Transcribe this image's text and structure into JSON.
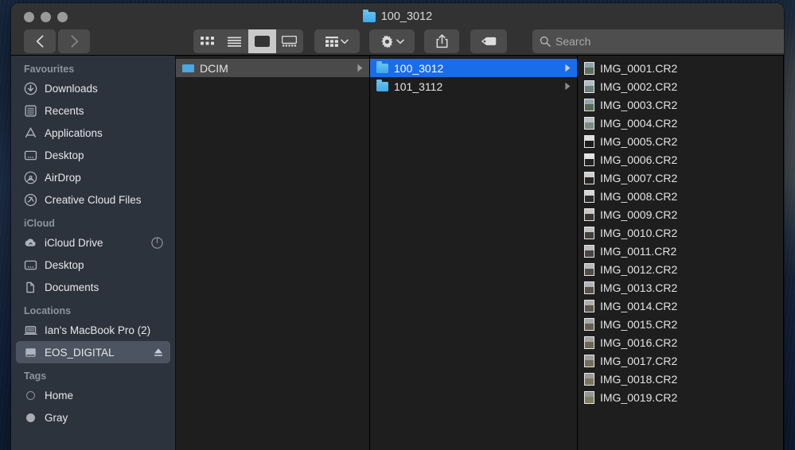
{
  "window": {
    "title": "100_3012",
    "title_icon": "folder-icon"
  },
  "toolbar": {
    "back_label": "Back",
    "forward_label": "Forward",
    "view_modes": [
      {
        "name": "icon-view",
        "label": "Icon View",
        "active": false
      },
      {
        "name": "list-view",
        "label": "List View",
        "active": false
      },
      {
        "name": "column-view",
        "label": "Column View",
        "active": true
      },
      {
        "name": "gallery-view",
        "label": "Gallery View",
        "active": false
      }
    ],
    "arrange_label": "Group",
    "action_label": "Action",
    "share_label": "Share",
    "tags_label": "Tags",
    "search": {
      "placeholder": "Search",
      "value": ""
    }
  },
  "sidebar": {
    "sections": [
      {
        "header": "Favourites",
        "items": [
          {
            "label": "Downloads",
            "icon": "downloads-icon",
            "selected": false
          },
          {
            "label": "Recents",
            "icon": "recents-icon",
            "selected": false
          },
          {
            "label": "Applications",
            "icon": "applications-icon",
            "selected": false
          },
          {
            "label": "Desktop",
            "icon": "desktop-icon",
            "selected": false
          },
          {
            "label": "AirDrop",
            "icon": "airdrop-icon",
            "selected": false
          },
          {
            "label": "Creative Cloud Files",
            "icon": "creative-cloud-icon",
            "selected": false
          }
        ]
      },
      {
        "header": "iCloud",
        "items": [
          {
            "label": "iCloud Drive",
            "icon": "icloud-drive-icon",
            "selected": false,
            "accessory": "sync-progress-icon"
          },
          {
            "label": "Desktop",
            "icon": "desktop-icon",
            "selected": false
          },
          {
            "label": "Documents",
            "icon": "documents-icon",
            "selected": false
          }
        ]
      },
      {
        "header": "Locations",
        "items": [
          {
            "label": "Ian's MacBook Pro (2)",
            "icon": "laptop-icon",
            "selected": false
          },
          {
            "label": "EOS_DIGITAL",
            "icon": "external-drive-icon",
            "selected": true,
            "accessory": "eject-icon"
          }
        ]
      },
      {
        "header": "Tags",
        "items": [
          {
            "label": "Home",
            "icon": "tag-dot-hollow",
            "selected": false
          },
          {
            "label": "Gray",
            "icon": "tag-dot-gray",
            "selected": false
          }
        ]
      }
    ]
  },
  "columns": [
    {
      "name": "column-dcim",
      "items": [
        {
          "label": "DCIM",
          "kind": "folder-small",
          "selection": "gray",
          "has_disclosure": true
        }
      ]
    },
    {
      "name": "column-folders",
      "items": [
        {
          "label": "100_3012",
          "kind": "folder",
          "selection": "blue",
          "has_disclosure": true
        },
        {
          "label": "101_3112",
          "kind": "folder",
          "selection": "none",
          "has_disclosure": true
        }
      ]
    },
    {
      "name": "column-files",
      "items": [
        {
          "label": "IMG_0001.CR2",
          "kind": "image",
          "selection": "none",
          "has_disclosure": false
        },
        {
          "label": "IMG_0002.CR2",
          "kind": "image",
          "selection": "none",
          "has_disclosure": false
        },
        {
          "label": "IMG_0003.CR2",
          "kind": "image",
          "selection": "none",
          "has_disclosure": false
        },
        {
          "label": "IMG_0004.CR2",
          "kind": "image",
          "selection": "none",
          "has_disclosure": false
        },
        {
          "label": "IMG_0005.CR2",
          "kind": "image",
          "selection": "none",
          "has_disclosure": false
        },
        {
          "label": "IMG_0006.CR2",
          "kind": "image",
          "selection": "none",
          "has_disclosure": false
        },
        {
          "label": "IMG_0007.CR2",
          "kind": "image",
          "selection": "none",
          "has_disclosure": false
        },
        {
          "label": "IMG_0008.CR2",
          "kind": "image",
          "selection": "none",
          "has_disclosure": false
        },
        {
          "label": "IMG_0009.CR2",
          "kind": "image",
          "selection": "none",
          "has_disclosure": false
        },
        {
          "label": "IMG_0010.CR2",
          "kind": "image",
          "selection": "none",
          "has_disclosure": false
        },
        {
          "label": "IMG_0011.CR2",
          "kind": "image",
          "selection": "none",
          "has_disclosure": false
        },
        {
          "label": "IMG_0012.CR2",
          "kind": "image",
          "selection": "none",
          "has_disclosure": false
        },
        {
          "label": "IMG_0013.CR2",
          "kind": "image",
          "selection": "none",
          "has_disclosure": false
        },
        {
          "label": "IMG_0014.CR2",
          "kind": "image",
          "selection": "none",
          "has_disclosure": false
        },
        {
          "label": "IMG_0015.CR2",
          "kind": "image",
          "selection": "none",
          "has_disclosure": false
        },
        {
          "label": "IMG_0016.CR2",
          "kind": "image",
          "selection": "none",
          "has_disclosure": false
        },
        {
          "label": "IMG_0017.CR2",
          "kind": "image",
          "selection": "none",
          "has_disclosure": false
        },
        {
          "label": "IMG_0018.CR2",
          "kind": "image",
          "selection": "none",
          "has_disclosure": false
        },
        {
          "label": "IMG_0019.CR2",
          "kind": "image",
          "selection": "none",
          "has_disclosure": false
        }
      ]
    }
  ],
  "colors": {
    "selection_blue": "#1a6dea",
    "sidebar_bg": "#2d333d",
    "toolbar_bg": "#323232",
    "content_bg": "#1e1e1e",
    "folder_blue": "#4aa8e0"
  }
}
